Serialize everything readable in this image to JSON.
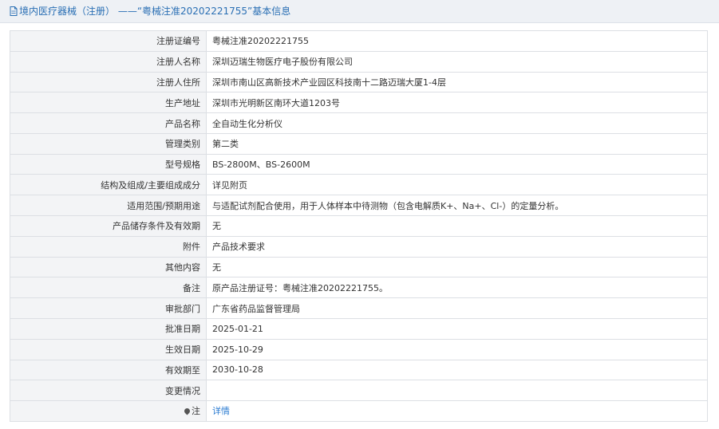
{
  "header": {
    "icon": "document-icon",
    "title": "境内医疗器械（注册） ——“粤械注准20202221755”基本信息"
  },
  "rows": [
    {
      "label": "注册证编号",
      "value": "粤械注准20202221755"
    },
    {
      "label": "注册人名称",
      "value": "深圳迈瑞生物医疗电子股份有限公司"
    },
    {
      "label": "注册人住所",
      "value": "深圳市南山区高新技术产业园区科技南十二路迈瑞大厦1-4层"
    },
    {
      "label": "生产地址",
      "value": "深圳市光明新区南环大道1203号"
    },
    {
      "label": "产品名称",
      "value": "全自动生化分析仪"
    },
    {
      "label": "管理类别",
      "value": "第二类"
    },
    {
      "label": "型号规格",
      "value": "BS-2800M、BS-2600M"
    },
    {
      "label": "结构及组成/主要组成成分",
      "value": "详见附页"
    },
    {
      "label": "适用范围/预期用途",
      "value": "与适配试剂配合使用，用于人体样本中待测物（包含电解质K+、Na+、Cl-）的定量分析。"
    },
    {
      "label": "产品储存条件及有效期",
      "value": "无"
    },
    {
      "label": "附件",
      "value": "产品技术要求"
    },
    {
      "label": "其他内容",
      "value": "无"
    },
    {
      "label": "备注",
      "value": "原产品注册证号：粤械注准20202221755。"
    },
    {
      "label": "审批部门",
      "value": "广东省药品监督管理局"
    },
    {
      "label": "批准日期",
      "value": "2025-01-21"
    },
    {
      "label": "生效日期",
      "value": "2025-10-29"
    },
    {
      "label": "有效期至",
      "value": "2030-10-28"
    },
    {
      "label": "变更情况",
      "value": ""
    }
  ],
  "note_row": {
    "icon": "pin-icon",
    "label": "注",
    "link_text": "详情"
  },
  "colors": {
    "header_bg": "#eef1f5",
    "title_text": "#2a6fb4",
    "label_bg": "#f3f4f6",
    "border": "#dcdfe4",
    "link": "#2a7bd1"
  }
}
